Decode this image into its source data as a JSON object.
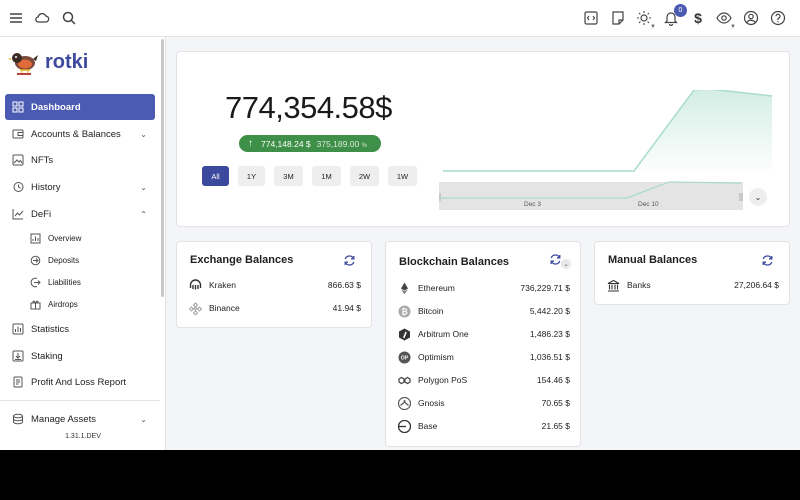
{
  "app": {
    "name": "rotki",
    "version": "1.31.1.DEV"
  },
  "topbar": {
    "notification_count": "0",
    "currency_symbol": "$",
    "icons": [
      "menu-icon",
      "cloud-icon",
      "search-icon",
      "code-icon",
      "note-icon",
      "theme-icon",
      "notifications-icon",
      "currency-icon",
      "privacy-icon",
      "account-icon",
      "help-icon"
    ]
  },
  "sidebar": {
    "items": [
      {
        "label": "Dashboard",
        "icon": "dashboard-icon",
        "active": true
      },
      {
        "label": "Accounts & Balances",
        "icon": "wallet-icon",
        "expandable": true
      },
      {
        "label": "NFTs",
        "icon": "image-icon"
      },
      {
        "label": "History",
        "icon": "history-icon",
        "expandable": true
      },
      {
        "label": "DeFi",
        "icon": "chart-line-icon",
        "expanded": true
      },
      {
        "label": "Statistics",
        "icon": "statistics-icon"
      },
      {
        "label": "Staking",
        "icon": "staking-icon"
      },
      {
        "label": "Profit And Loss Report",
        "icon": "report-icon"
      },
      {
        "label": "Manage Assets",
        "icon": "assets-icon",
        "expandable": true
      }
    ],
    "defi_subitems": [
      {
        "label": "Overview",
        "icon": "overview-icon"
      },
      {
        "label": "Deposits",
        "icon": "deposits-icon"
      },
      {
        "label": "Liabilities",
        "icon": "liabilities-icon"
      },
      {
        "label": "Airdrops",
        "icon": "airdrops-icon"
      }
    ]
  },
  "overview": {
    "total_value": "774,354.58",
    "currency": "$",
    "change_value": "774,148.24 $",
    "change_percent": "375,189.00",
    "percent_symbol": "%",
    "ranges": [
      "All",
      "1Y",
      "3M",
      "1M",
      "2W",
      "1W"
    ],
    "selected_range": "All",
    "chart_ticks": [
      "Dec 3",
      "Dec 10"
    ],
    "accent_color": "#4b5bb3",
    "gain_color": "#3e8f47",
    "chart_color": "#a8dcc8"
  },
  "exchange_balances": {
    "title": "Exchange Balances",
    "rows": [
      {
        "name": "Kraken",
        "icon": "kraken-icon",
        "amount": "866.63 $"
      },
      {
        "name": "Binance",
        "icon": "binance-icon",
        "amount": "41.94 $"
      }
    ]
  },
  "blockchain_balances": {
    "title": "Blockchain Balances",
    "rows": [
      {
        "name": "Ethereum",
        "icon": "ethereum-icon",
        "amount": "736,229.71 $"
      },
      {
        "name": "Bitcoin",
        "icon": "bitcoin-icon",
        "amount": "5,442.20 $"
      },
      {
        "name": "Arbitrum One",
        "icon": "arbitrum-icon",
        "amount": "1,486.23 $"
      },
      {
        "name": "Optimism",
        "icon": "optimism-icon",
        "amount": "1,036.51 $"
      },
      {
        "name": "Polygon PoS",
        "icon": "polygon-icon",
        "amount": "154.46 $"
      },
      {
        "name": "Gnosis",
        "icon": "gnosis-icon",
        "amount": "70.65 $"
      },
      {
        "name": "Base",
        "icon": "base-icon",
        "amount": "21.65 $"
      }
    ]
  },
  "manual_balances": {
    "title": "Manual Balances",
    "rows": [
      {
        "name": "Banks",
        "icon": "bank-icon",
        "amount": "27,206.64 $"
      }
    ]
  }
}
